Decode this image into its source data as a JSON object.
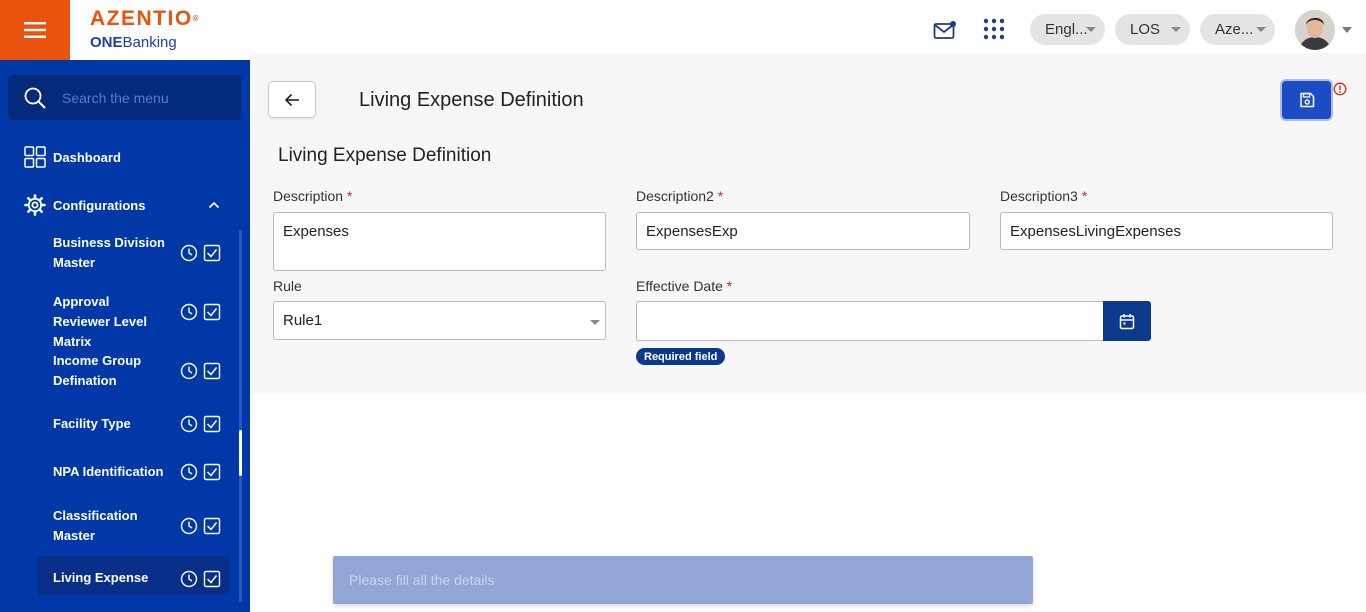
{
  "header": {
    "logo": {
      "brand": "AZENTIO",
      "product_bold": "ONE",
      "product_rest": "Banking"
    },
    "language": "Engl...",
    "module": "LOS",
    "organization": "Aze..."
  },
  "sidebar": {
    "search_placeholder": "Search the menu",
    "dashboard": "Dashboard",
    "configurations": "Configurations",
    "items": [
      {
        "label": "Business Division Master"
      },
      {
        "label": "Approval Reviewer Level Matrix"
      },
      {
        "label": "Income Group Defination"
      },
      {
        "label": "Facility Type"
      },
      {
        "label": "NPA Identification"
      },
      {
        "label": "Classification Master"
      },
      {
        "label": "Living Expense",
        "active": true
      }
    ]
  },
  "page": {
    "title": "Living Expense Definition",
    "form_title": "Living Expense Definition",
    "required_mark": "*"
  },
  "form": {
    "description": {
      "label": "Description",
      "value": "Expenses"
    },
    "description2": {
      "label": "Description2",
      "value": "ExpensesExp"
    },
    "description3": {
      "label": "Description3",
      "value": "ExpensesLivingExpenses"
    },
    "rule": {
      "label": "Rule",
      "value": "Rule1"
    },
    "effective_date": {
      "label": "Effective Date",
      "value": "",
      "error": "Required field"
    }
  },
  "toast": {
    "message": "Please fill all the details"
  },
  "colors": {
    "brand_orange": "#e8530e",
    "sidebar_blue": "#0038a8",
    "primary_button": "#1c4cc4",
    "required_red": "#d9251d"
  }
}
